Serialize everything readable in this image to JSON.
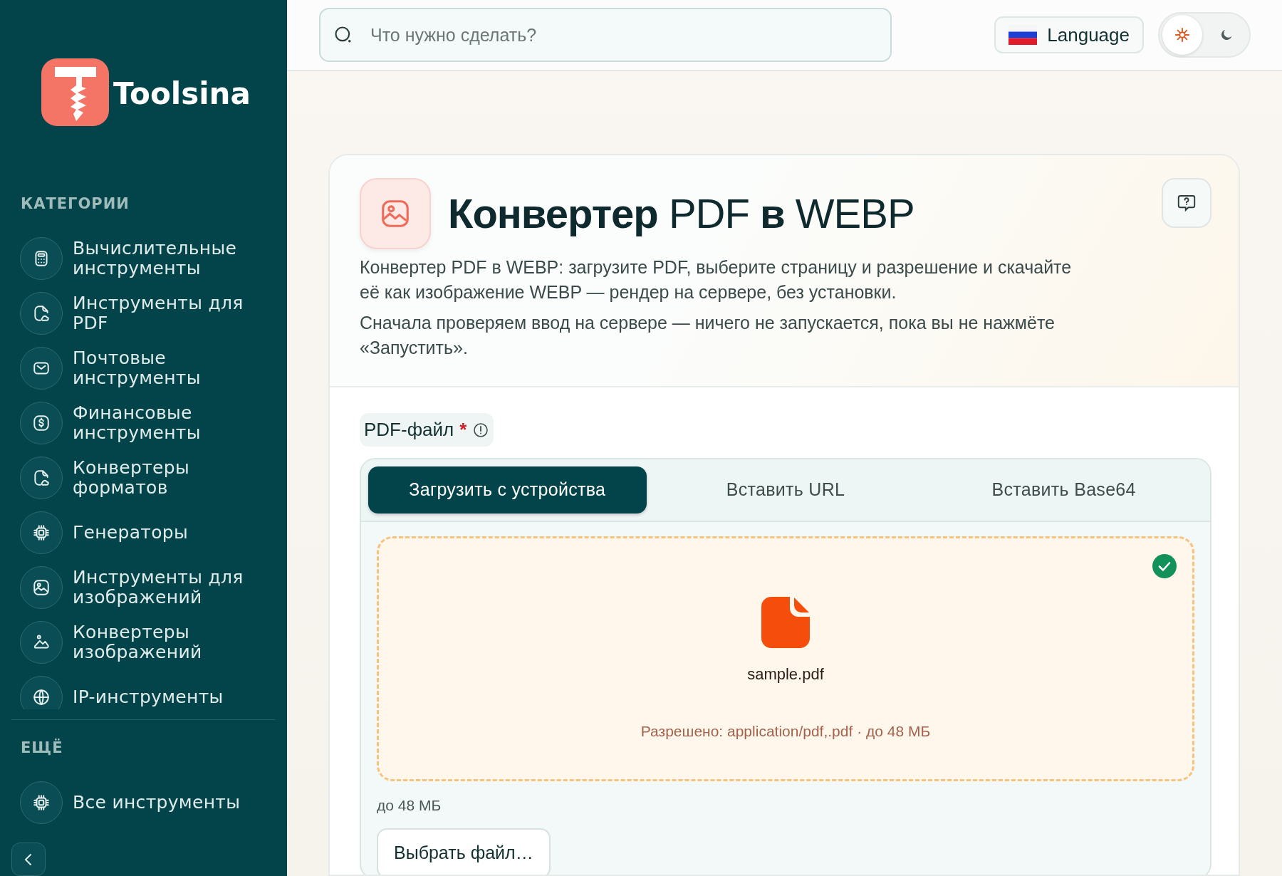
{
  "sidebar": {
    "logo": {
      "text": "Toolsina"
    },
    "sections": [
      {
        "title": "КАТЕГОРИИ",
        "items": [
          {
            "label": "Вычислительные инструменты"
          },
          {
            "label": "Инструменты для PDF"
          },
          {
            "label": "Почтовые инструменты"
          },
          {
            "label": "Финансовые инструменты"
          },
          {
            "label": "Конвертеры форматов"
          },
          {
            "label": "Генераторы"
          },
          {
            "label": "Инструменты для изображений"
          },
          {
            "label": "Конвертеры изображений"
          },
          {
            "label": "IP-инструменты"
          }
        ]
      },
      {
        "title": "ЕЩЁ",
        "items": [
          {
            "label": "Все инструменты"
          }
        ]
      }
    ]
  },
  "header": {
    "search": {
      "placeholder": "Что нужно сделать?"
    },
    "language": "Language",
    "theme": [
      {
        "kind": "light",
        "selected": true
      },
      {
        "kind": "dark",
        "selected": false
      }
    ]
  },
  "tool": {
    "title": "**Конвертер** PDF **в** WEBP",
    "description": [
      "Конвертер PDF в WEBP: загрузите PDF, выберите страницу и разрешение и скачайте её как изображение WEBP — рендер на сервере, без установки.",
      "Сначала проверяем ввод на сервере — ничего не запускается, пока вы не нажмёте «Запустить»."
    ],
    "field": {
      "label": "PDF-файл",
      "required_mark": "*"
    },
    "tabs": [
      {
        "label": "Загрузить с устройства",
        "selected": true
      },
      {
        "label": "Вставить URL",
        "selected": false
      },
      {
        "label": "Вставить Base64",
        "selected": false
      }
    ],
    "dropzone": {
      "file_name": "sample.pdf",
      "hint": "Разрешено: application/pdf,.pdf · до 48 МБ",
      "valid": true
    },
    "size_note": "до 48 МБ",
    "choose_button": "Выбрать файл…"
  }
}
